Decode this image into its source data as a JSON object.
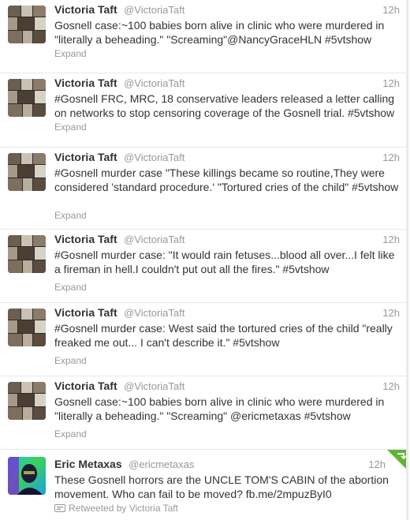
{
  "tweets": [
    {
      "fullname": "Victoria Taft",
      "username": "@VictoriaTaft",
      "time": "12h",
      "text": "Gosnell case:~100 babies born alive in clinic who were murdered in \"literally a beheading.\" \"Screaming\"@NancyGraceHLN #5vtshow",
      "expand": "Expand"
    },
    {
      "fullname": "Victoria Taft",
      "username": "@VictoriaTaft",
      "time": "12h",
      "text": "#Gosnell FRC, MRC, 18 conservative leaders released a letter calling on networks to stop censoring coverage of the Gosnell trial. #5vtshow",
      "expand": "Expand"
    },
    {
      "fullname": "Victoria Taft",
      "username": "@VictoriaTaft",
      "time": "12h",
      "text": "#Gosnell murder case \"These killings became so routine,They were considered 'standard procedure.' \"Tortured cries of the child\" #5vtshow",
      "expand": "Expand"
    },
    {
      "fullname": "Victoria Taft",
      "username": "@VictoriaTaft",
      "time": "12h",
      "text": "#Gosnell murder case: \"It would rain fetuses...blood all over...I felt like a fireman in hell.I couldn't put out all the fires.\" #5vtshow",
      "expand": "Expand"
    },
    {
      "fullname": "Victoria Taft",
      "username": "@VictoriaTaft",
      "time": "12h",
      "text": "#Gosnell murder case: West said the tortured cries of the child \"really freaked me out... I can't describe it.\" #5vtshow",
      "expand": "Expand"
    },
    {
      "fullname": "Victoria Taft",
      "username": "@VictoriaTaft",
      "time": "12h",
      "text": "Gosnell case:~100 babies born alive in clinic who were murdered in \"literally a beheading.\" \"Screaming\" @ericmetaxas #5vtshow",
      "expand": "Expand"
    }
  ],
  "retweet": {
    "fullname": "Eric Metaxas",
    "username": "@ericmetaxas",
    "time": "12h",
    "text": "These Gosnell horrors are the UNCLE TOM'S CABIN of the abortion movement. Who can fail to be moved? fb.me/2mpuzByI0",
    "retweeted_by": "Retweeted by Victoria Taft",
    "badge_color": "#5fb336"
  },
  "colors": {
    "name": "#333333",
    "meta": "#999999",
    "divider": "#e8e8e8"
  },
  "icons": {
    "victoria_avatar": "avatar-photo-collage",
    "eric_avatar": "avatar-photo",
    "retweet": "retweet-icon",
    "corner": "retweet-corner-badge"
  }
}
